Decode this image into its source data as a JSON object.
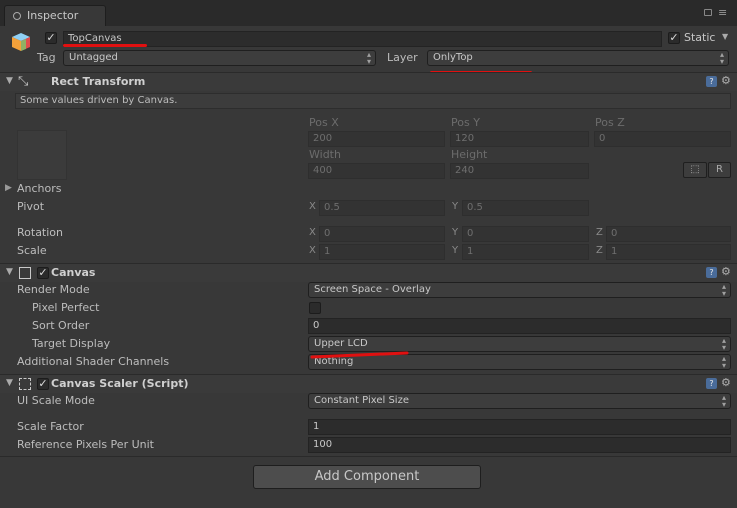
{
  "tab": {
    "title": "Inspector",
    "icon": "info-icon",
    "lock_icon": "lock-icon",
    "menu_icon": "menu-icon"
  },
  "gameobject": {
    "active": true,
    "name": "TopCanvas",
    "static_label": "Static",
    "static_checked": true,
    "tag_label": "Tag",
    "tag_value": "Untagged",
    "layer_label": "Layer",
    "layer_value": "OnlyTop"
  },
  "rect_transform": {
    "title": "Rect Transform",
    "info": "Some values driven by Canvas.",
    "pos_x_label": "Pos X",
    "pos_y_label": "Pos Y",
    "pos_z_label": "Pos Z",
    "pos_x": "200",
    "pos_y": "120",
    "pos_z": "0",
    "width_label": "Width",
    "height_label": "Height",
    "width": "400",
    "height": "240",
    "r_button": "R",
    "anchors_label": "Anchors",
    "pivot_label": "Pivot",
    "pivot_x": "0.5",
    "pivot_y": "0.5",
    "rotation_label": "Rotation",
    "rot_x": "0",
    "rot_y": "0",
    "rot_z": "0",
    "scale_label": "Scale",
    "scale_x": "1",
    "scale_y": "1",
    "scale_z": "1",
    "axis_x": "X",
    "axis_y": "Y",
    "axis_z": "Z"
  },
  "canvas": {
    "title": "Canvas",
    "enabled": true,
    "render_mode_label": "Render Mode",
    "render_mode": "Screen Space - Overlay",
    "pixel_perfect_label": "Pixel Perfect",
    "pixel_perfect": false,
    "sort_order_label": "Sort Order",
    "sort_order": "0",
    "target_display_label": "Target Display",
    "target_display": "Upper LCD",
    "shader_channels_label": "Additional Shader Channels",
    "shader_channels": "Nothing"
  },
  "canvas_scaler": {
    "title": "Canvas Scaler (Script)",
    "enabled": true,
    "ui_scale_mode_label": "UI Scale Mode",
    "ui_scale_mode": "Constant Pixel Size",
    "scale_factor_label": "Scale Factor",
    "scale_factor": "1",
    "ref_pixels_label": "Reference Pixels Per Unit",
    "ref_pixels": "100"
  },
  "add_component_label": "Add Component",
  "colors": {
    "annotation": "#e01010",
    "help_icon": "#4a6c9a",
    "background": "#383838"
  }
}
